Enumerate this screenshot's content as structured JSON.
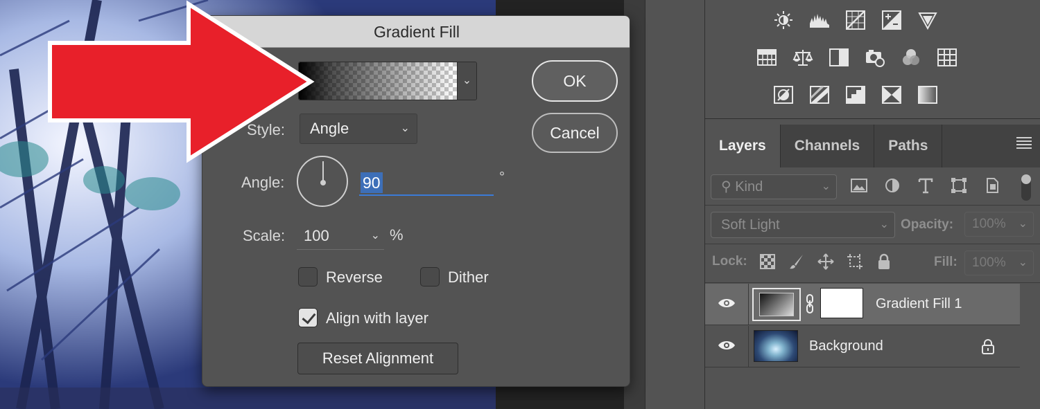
{
  "dialog": {
    "title": "Gradient Fill",
    "ok_label": "OK",
    "cancel_label": "Cancel",
    "style_label": "Style:",
    "style_value": "Angle",
    "angle_label": "Angle:",
    "angle_value": "90",
    "angle_unit": "°",
    "scale_label": "Scale:",
    "scale_value": "100",
    "scale_unit": "%",
    "reverse_label": "Reverse",
    "reverse_checked": false,
    "dither_label": "Dither",
    "dither_checked": false,
    "align_label": "Align with layer",
    "align_checked": true,
    "reset_label": "Reset Alignment"
  },
  "layers_panel": {
    "tabs": [
      {
        "label": "Layers",
        "active": true
      },
      {
        "label": "Channels",
        "active": false
      },
      {
        "label": "Paths",
        "active": false
      }
    ],
    "filter_kind": "Kind",
    "blend_mode": "Soft Light",
    "opacity_label": "Opacity:",
    "opacity_value": "100%",
    "lock_label": "Lock:",
    "fill_label": "Fill:",
    "fill_value": "100%",
    "layers": [
      {
        "name": "Gradient Fill 1",
        "selected": true,
        "visible": true
      },
      {
        "name": "Background",
        "selected": false,
        "visible": true,
        "locked": true
      }
    ]
  },
  "adjustments": {
    "row1": [
      "brightness-contrast-icon",
      "levels-icon",
      "curves-icon",
      "exposure-icon",
      "vibrance-icon"
    ],
    "row2": [
      "hue-saturation-icon",
      "color-balance-icon",
      "black-white-icon",
      "photo-filter-icon",
      "channel-mixer-icon",
      "color-lookup-icon"
    ],
    "row3": [
      "invert-icon",
      "posterize-icon",
      "threshold-icon",
      "selective-color-icon",
      "gradient-map-icon"
    ]
  },
  "colors": {
    "arrow_red": "#e8202a",
    "selection_blue": "#3d6fb8",
    "panel_bg": "#535353"
  }
}
